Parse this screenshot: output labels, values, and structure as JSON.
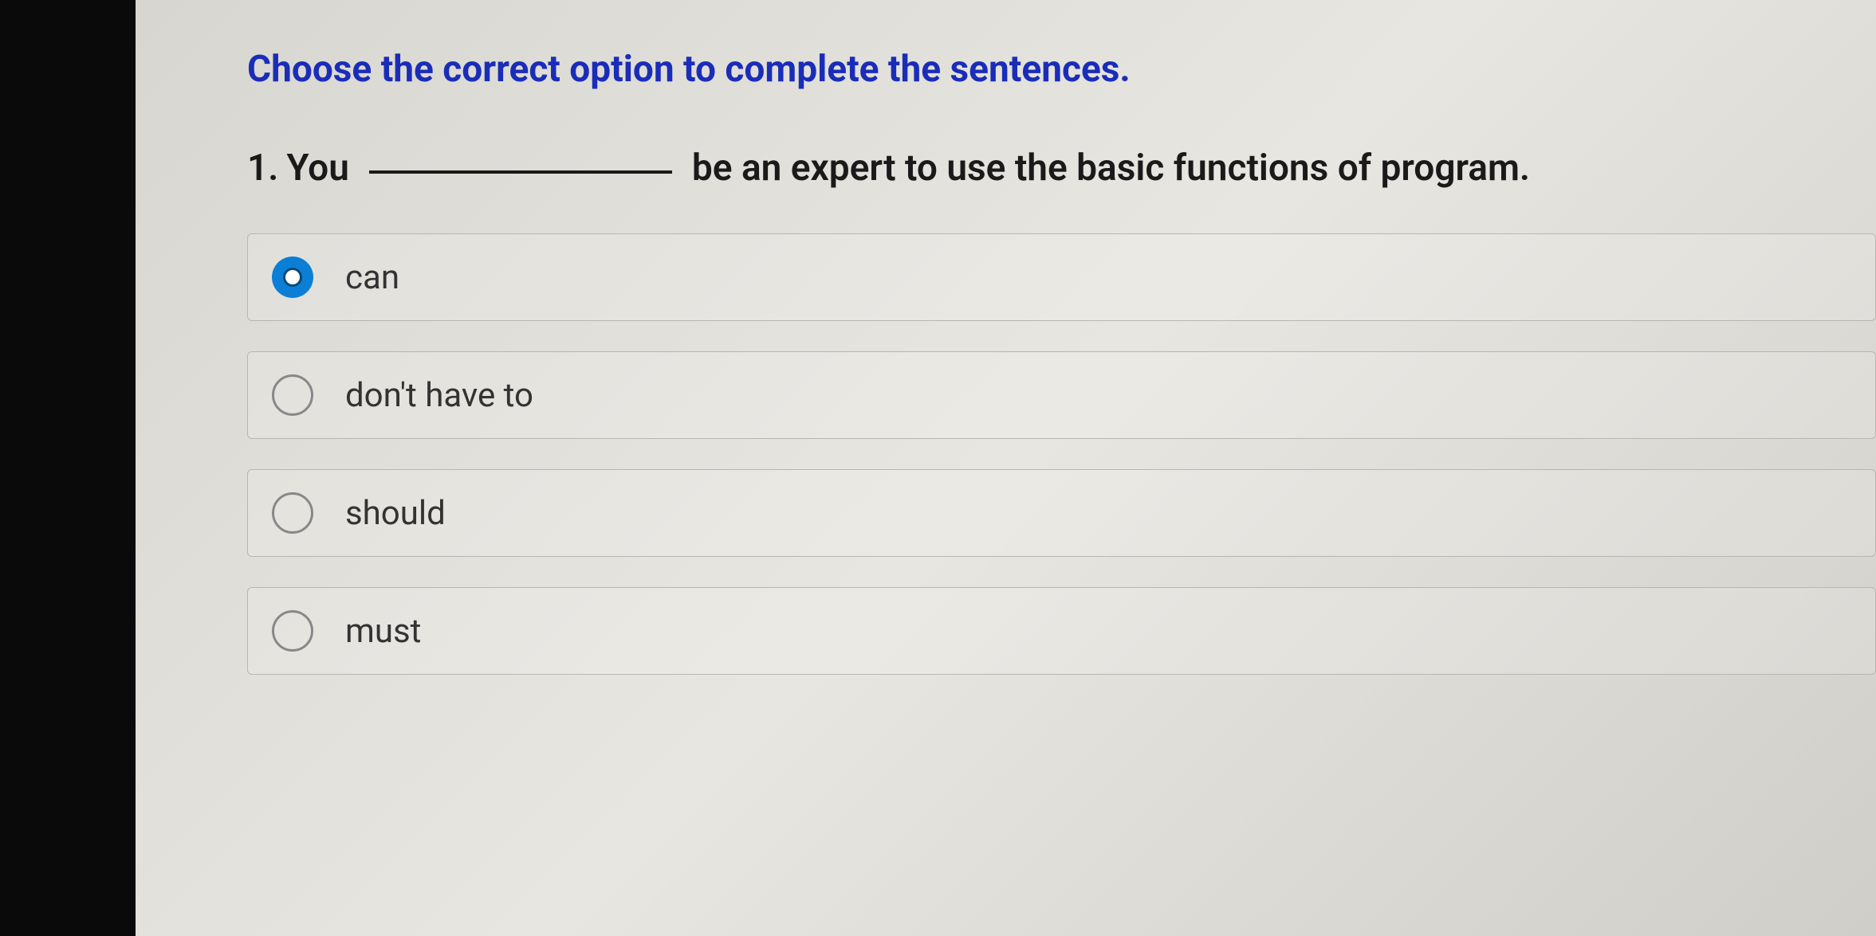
{
  "instruction": "Choose the correct option to complete the sentences.",
  "question": {
    "number": "1.",
    "prefix": "You",
    "suffix": "be an expert to use the basic functions of program."
  },
  "options": [
    {
      "label": "can",
      "selected": true
    },
    {
      "label": "don't have to",
      "selected": false
    },
    {
      "label": "should",
      "selected": false
    },
    {
      "label": "must",
      "selected": false
    }
  ]
}
